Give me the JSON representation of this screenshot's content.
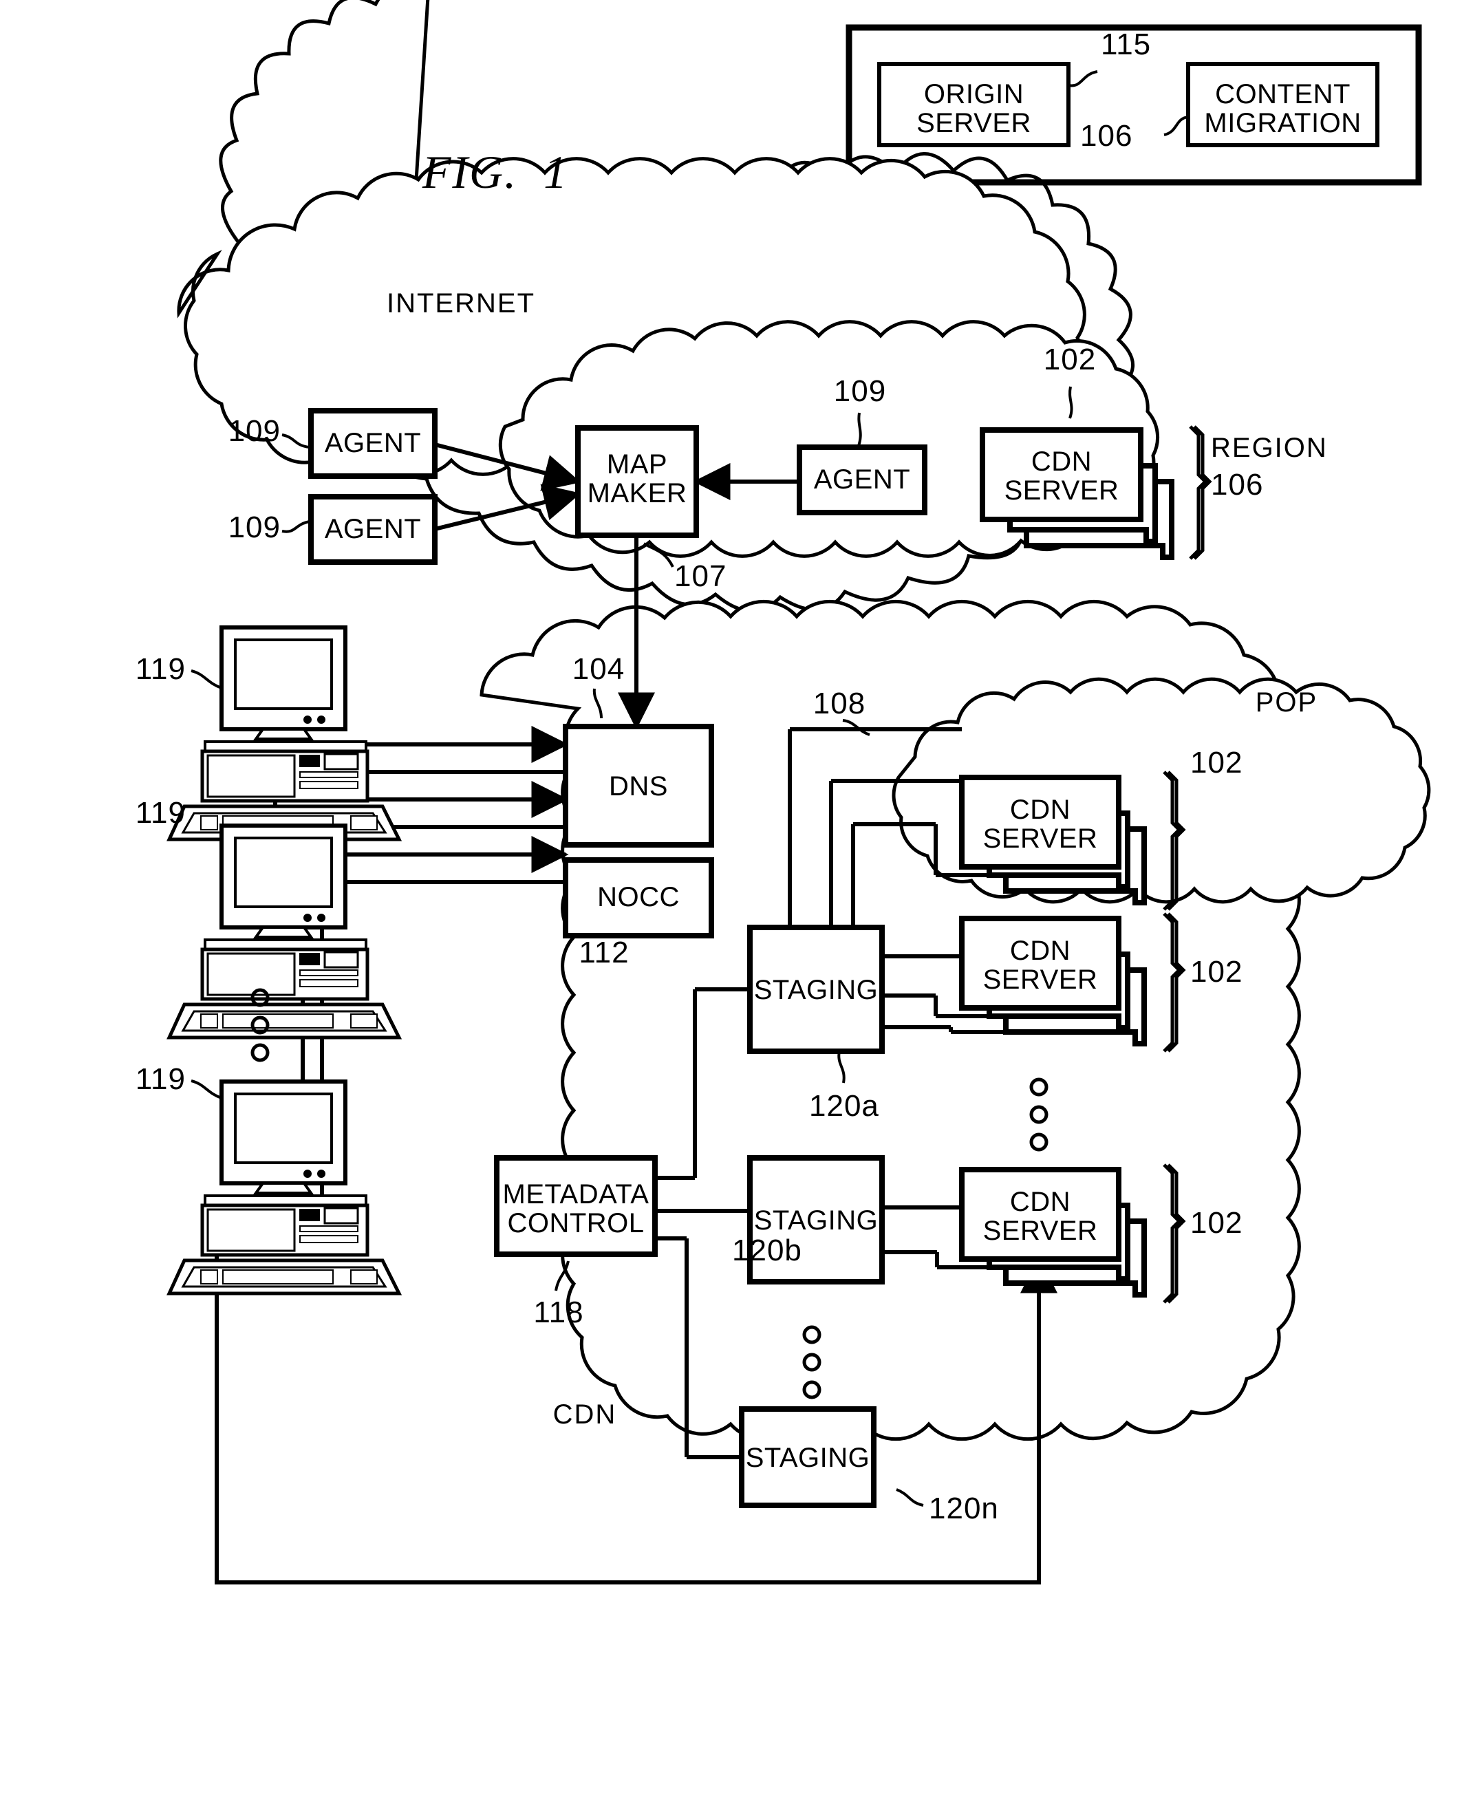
{
  "figure": {
    "title": "FIG.  1",
    "domain_note": "patent-diagram"
  },
  "top_panel": {
    "origin_server": "ORIGIN\nSERVER",
    "origin_server_ref": "115",
    "content_migration": "CONTENT\nMIGRATION",
    "content_migration_ref": "106"
  },
  "internet_cloud": {
    "name": "INTERNET",
    "agents": [
      {
        "label": "AGENT",
        "ref": "109"
      },
      {
        "label": "AGENT",
        "ref": "109"
      },
      {
        "label": "AGENT",
        "ref": "109"
      }
    ],
    "map_maker": {
      "label": "MAP\nMAKER",
      "ref": "107"
    },
    "region": {
      "name": "REGION",
      "ref": "106",
      "server": {
        "label": "CDN\nSERVER",
        "ref": "102"
      }
    }
  },
  "clients": [
    {
      "label": "119"
    },
    {
      "label": "119"
    },
    {
      "label": "119"
    }
  ],
  "clients_ellipsis": "○\n○\n○",
  "cdn_cloud": {
    "name": "CDN",
    "dns": {
      "label": "DNS",
      "ref": "104"
    },
    "nocc": {
      "label": "NOCC",
      "ref": "112"
    },
    "metadata_control": {
      "label": "METADATA\nCONTROL",
      "ref": "118"
    },
    "staging": [
      {
        "label": "STAGING",
        "ref": "120a"
      },
      {
        "label": "STAGING",
        "ref": "120b"
      },
      {
        "label": "STAGING",
        "ref": "120n"
      }
    ],
    "staging_ellipsis": "○\n○\n○",
    "pop": {
      "name": "POP",
      "ref": "108",
      "server": {
        "label": "CDN\nSERVER",
        "ref": "102"
      }
    },
    "server_groups": [
      {
        "label": "CDN\nSERVER",
        "ref": "102"
      },
      {
        "label": "CDN\nSERVER",
        "ref": "102"
      }
    ],
    "server_ellipsis": "○\n○\n○"
  },
  "colors": {
    "ink": "#000000",
    "paper": "#ffffff"
  }
}
